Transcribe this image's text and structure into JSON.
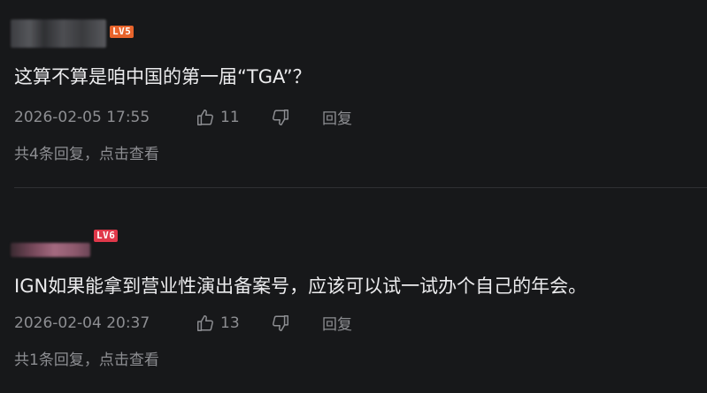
{
  "comments": [
    {
      "level_badge": "LV5",
      "text": "这算不算是咱中国的第一届“TGA”？",
      "timestamp": "2026-02-05 17:55",
      "likes": "11",
      "reply_label": "回复",
      "replies_link": "共4条回复，点击查看"
    },
    {
      "level_badge": "LV6",
      "text": "IGN如果能拿到营业性演出备案号，应该可以试一试办个自己的年会。",
      "timestamp": "2026-02-04 20:37",
      "likes": "13",
      "reply_label": "回复",
      "replies_link": "共1条回复，点击查看"
    }
  ],
  "icons": {
    "like": "thumbs-up-icon",
    "dislike": "thumbs-down-icon"
  },
  "colors": {
    "background": "#17181a",
    "text": "#ececee",
    "muted": "#8d8e92",
    "lv5_badge": "#e8642c",
    "lv6_badge": "#e0384a"
  }
}
